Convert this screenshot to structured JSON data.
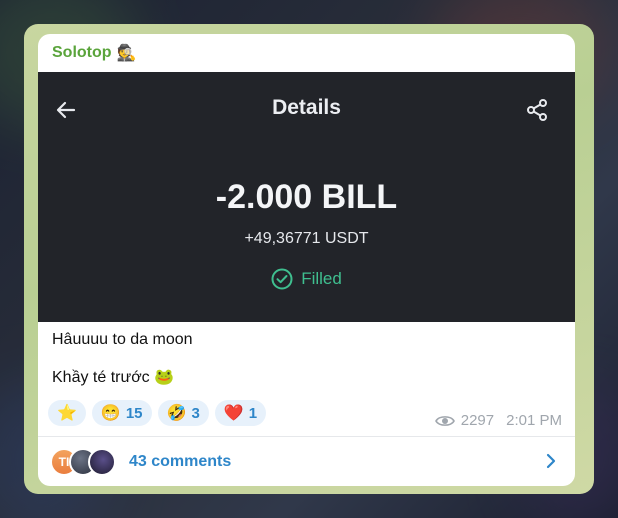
{
  "colors": {
    "accent": "#2e86c9",
    "sender": "#5aa43b",
    "filled": "#3fbf8f",
    "dark_panel": "#222429"
  },
  "post": {
    "sender": "Solotop",
    "sender_emoji": "🕵️"
  },
  "screenshot": {
    "title": "Details",
    "amount": "-2.000 BILL",
    "usdt": "+49,36771 USDT",
    "status": "Filled"
  },
  "message": {
    "line1": "Hâuuuu to da moon",
    "line2": "Khầy té trước",
    "line2_emoji": "🐸"
  },
  "reactions": [
    {
      "emoji": "⭐",
      "count": ""
    },
    {
      "emoji": "😁",
      "count": "15"
    },
    {
      "emoji": "🤣",
      "count": "3"
    },
    {
      "emoji": "❤️",
      "count": "1"
    }
  ],
  "meta": {
    "views": "2297",
    "time": "2:01 PM"
  },
  "comments": {
    "label": "43 comments",
    "avatar_initials": "TI"
  }
}
